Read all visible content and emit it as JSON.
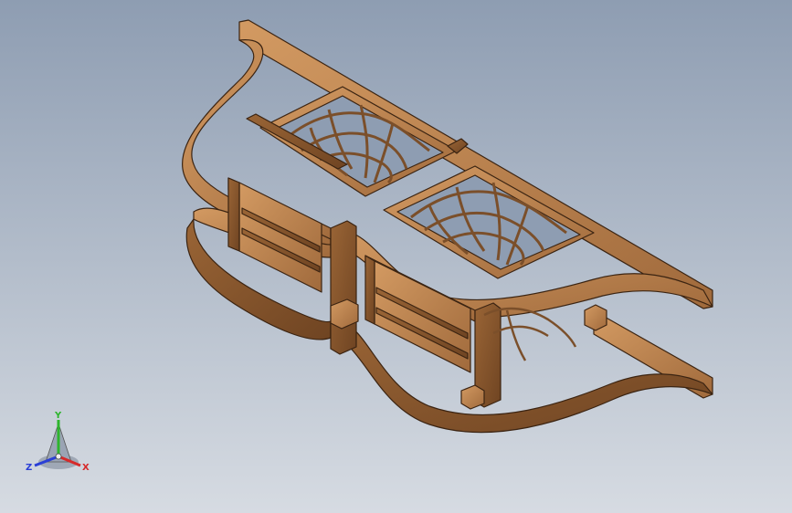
{
  "viewport": {
    "background_top": "#8e9db2",
    "background_bottom": "#d6dbe2",
    "model": {
      "material_color": "#b07a4a",
      "highlight_color": "#d39a62",
      "shadow_color": "#7b4f2a",
      "edge_color": "#3b2412"
    }
  },
  "triad": {
    "y_label": "Y",
    "x_label": "X",
    "z_label": "Z",
    "y_color": "#2db52d",
    "x_color": "#d62a2a",
    "z_color": "#2a3fd6"
  }
}
